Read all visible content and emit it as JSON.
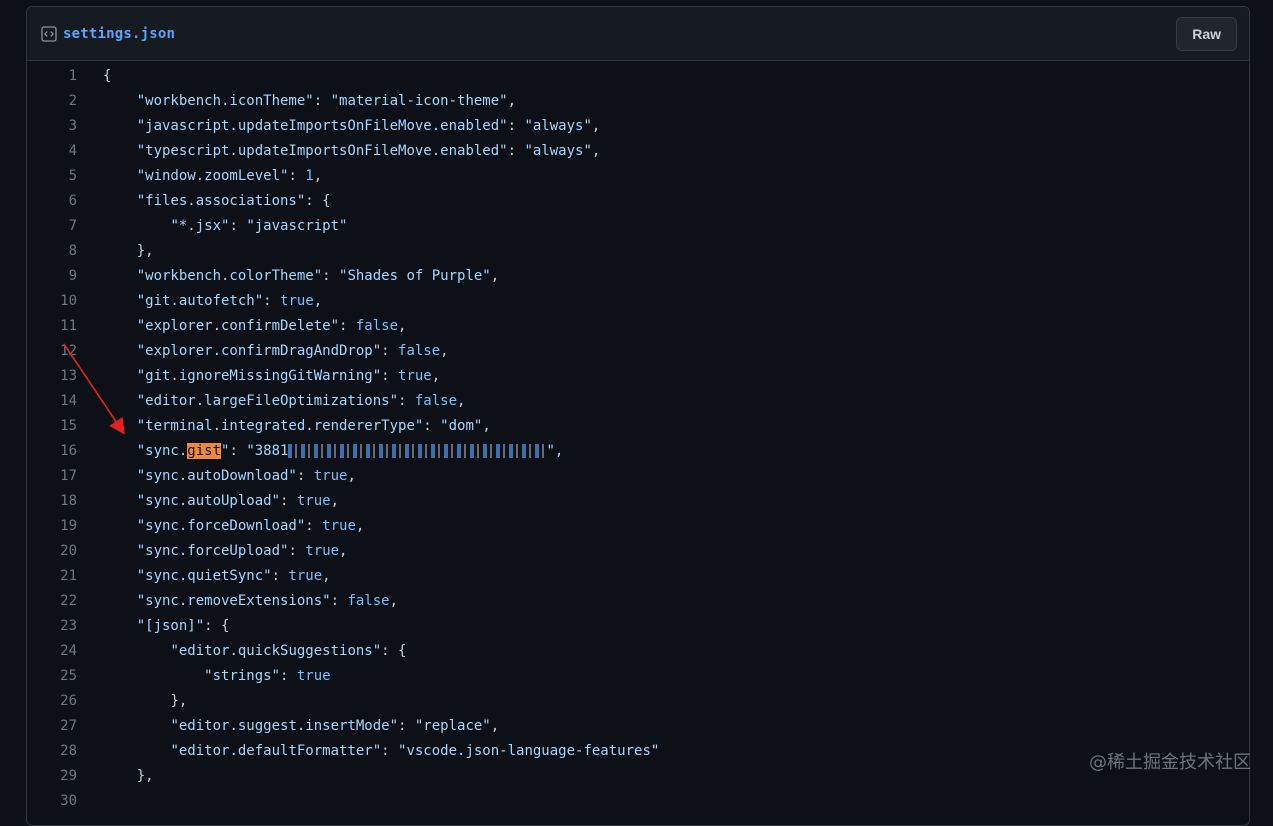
{
  "file": {
    "name": "settings.json",
    "raw_label": "Raw",
    "icon": "code-square-icon"
  },
  "lines": [
    {
      "n": "1",
      "indent": 0,
      "text": "{"
    },
    {
      "n": "2",
      "indent": 1,
      "key": "workbench.iconTheme",
      "value": "\"material-icon-theme\"",
      "vtype": "s",
      "tail": ","
    },
    {
      "n": "3",
      "indent": 1,
      "key": "javascript.updateImportsOnFileMove.enabled",
      "value": "\"always\"",
      "vtype": "s",
      "tail": ","
    },
    {
      "n": "4",
      "indent": 1,
      "key": "typescript.updateImportsOnFileMove.enabled",
      "value": "\"always\"",
      "vtype": "s",
      "tail": ","
    },
    {
      "n": "5",
      "indent": 1,
      "key": "window.zoomLevel",
      "value": "1",
      "vtype": "b",
      "tail": ","
    },
    {
      "n": "6",
      "indent": 1,
      "key": "files.associations",
      "value": "",
      "vtype": "p",
      "tail": "{"
    },
    {
      "n": "7",
      "indent": 2,
      "key": "*.jsx",
      "value": "\"javascript\"",
      "vtype": "s",
      "tail": ""
    },
    {
      "n": "8",
      "indent": 1,
      "text": "},"
    },
    {
      "n": "9",
      "indent": 1,
      "key": "workbench.colorTheme",
      "value": "\"Shades of Purple\"",
      "vtype": "s",
      "tail": ","
    },
    {
      "n": "10",
      "indent": 1,
      "key": "git.autofetch",
      "value": "true",
      "vtype": "b",
      "tail": ","
    },
    {
      "n": "11",
      "indent": 1,
      "key": "explorer.confirmDelete",
      "value": "false",
      "vtype": "b",
      "tail": ","
    },
    {
      "n": "12",
      "indent": 1,
      "key": "explorer.confirmDragAndDrop",
      "value": "false",
      "vtype": "b",
      "tail": ","
    },
    {
      "n": "13",
      "indent": 1,
      "key": "git.ignoreMissingGitWarning",
      "value": "true",
      "vtype": "b",
      "tail": ","
    },
    {
      "n": "14",
      "indent": 1,
      "key": "editor.largeFileOptimizations",
      "value": "false",
      "vtype": "b",
      "tail": ","
    },
    {
      "n": "15",
      "indent": 1,
      "key": "terminal.integrated.rendererType",
      "value": "\"dom\"",
      "vtype": "s",
      "tail": ","
    },
    {
      "n": "16",
      "indent": 1,
      "key_prefix": "sync.",
      "key_highlight": "gist",
      "value": "\"3881",
      "vtype": "redacted",
      "tail": "\","
    },
    {
      "n": "17",
      "indent": 1,
      "key": "sync.autoDownload",
      "value": "true",
      "vtype": "b",
      "tail": ","
    },
    {
      "n": "18",
      "indent": 1,
      "key": "sync.autoUpload",
      "value": "true",
      "vtype": "b",
      "tail": ","
    },
    {
      "n": "19",
      "indent": 1,
      "key": "sync.forceDownload",
      "value": "true",
      "vtype": "b",
      "tail": ","
    },
    {
      "n": "20",
      "indent": 1,
      "key": "sync.forceUpload",
      "value": "true",
      "vtype": "b",
      "tail": ","
    },
    {
      "n": "21",
      "indent": 1,
      "key": "sync.quietSync",
      "value": "true",
      "vtype": "b",
      "tail": ","
    },
    {
      "n": "22",
      "indent": 1,
      "key": "sync.removeExtensions",
      "value": "false",
      "vtype": "b",
      "tail": ","
    },
    {
      "n": "23",
      "indent": 1,
      "key": "[json]",
      "value": "",
      "vtype": "p",
      "tail": "{"
    },
    {
      "n": "24",
      "indent": 2,
      "key": "editor.quickSuggestions",
      "value": "",
      "vtype": "p",
      "tail": "{"
    },
    {
      "n": "25",
      "indent": 3,
      "key": "strings",
      "value": "true",
      "vtype": "b",
      "tail": ""
    },
    {
      "n": "26",
      "indent": 2,
      "text": "},"
    },
    {
      "n": "27",
      "indent": 2,
      "key": "editor.suggest.insertMode",
      "value": "\"replace\"",
      "vtype": "s",
      "tail": ","
    },
    {
      "n": "28",
      "indent": 2,
      "key": "editor.defaultFormatter",
      "value": "\"vscode.json-language-features\"",
      "vtype": "s",
      "tail": ""
    },
    {
      "n": "29",
      "indent": 1,
      "text": "},"
    },
    {
      "n": "30",
      "indent": 1,
      "text": ""
    }
  ],
  "watermark": "@稀土掘金技术社区",
  "colors": {
    "background": "#0d1117",
    "link": "#58a6ff",
    "string": "#a5d6ff",
    "boolean": "#79c0ff",
    "highlight": "#f0883e",
    "arrow": "#e5201f"
  }
}
